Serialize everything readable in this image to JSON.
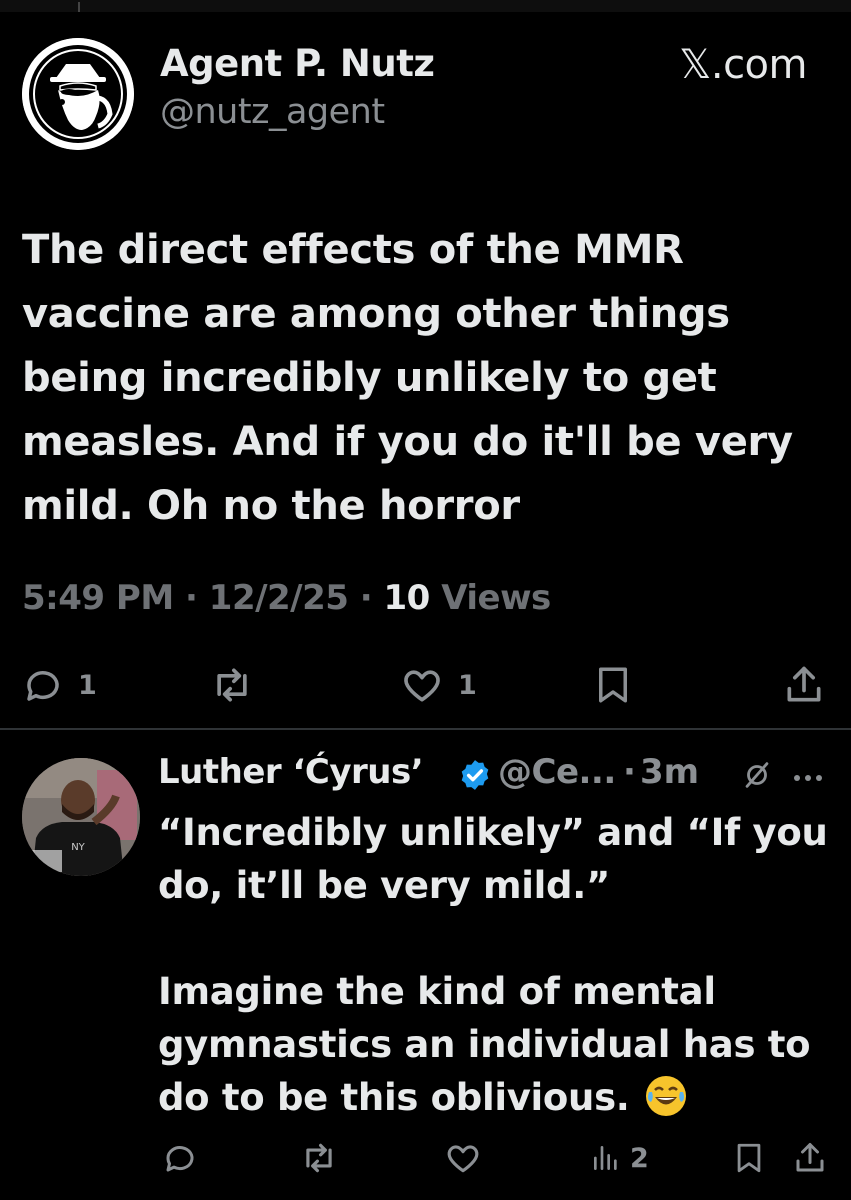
{
  "main_tweet": {
    "author_name": "Agent P. Nutz",
    "author_handle": "@nutz_agent",
    "site_label": "𝕏.com",
    "text": "The direct effects of the MMR vaccine are among other things being incredibly unlikely to get measles. And if you do it'll be very mild. Oh no the horror",
    "time": "5:49 PM",
    "separator": "·",
    "date": "12/2/25",
    "views_count": "10",
    "views_label": "Views",
    "actions": {
      "reply_icon": "reply-icon",
      "reply_count": "1",
      "repost_icon": "repost-icon",
      "like_icon": "heart-icon",
      "like_count": "1",
      "bookmark_icon": "bookmark-icon",
      "share_icon": "share-icon"
    }
  },
  "reply": {
    "author_name": "Luther ‘Ćyrus’",
    "verified_icon": "verified-badge-icon",
    "author_handle": "@Ce...",
    "separator": "·",
    "time": "3m",
    "text_line_1": "“Incredibly unlikely” and “If you do, it’ll be very mild.”",
    "text_line_2": "Imagine the kind of mental gymnastics an individual has to do to be this oblivious.",
    "emoji": "laughing-crying-emoji",
    "actions": {
      "reply_icon": "reply-icon",
      "repost_icon": "repost-icon",
      "like_icon": "heart-icon",
      "views_icon": "views-icon",
      "views_count": "2",
      "bookmark_icon": "bookmark-icon",
      "share_icon": "share-icon"
    }
  },
  "colors": {
    "background": "#000000",
    "primary_text": "#e7e9ea",
    "secondary_text": "#8b8f93",
    "verified": "#1d9bf0"
  }
}
